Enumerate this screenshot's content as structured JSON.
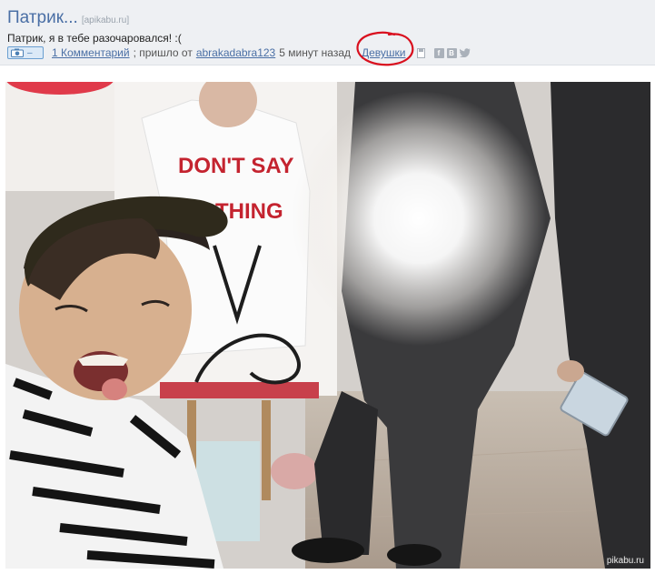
{
  "post": {
    "title": "Патрик...",
    "source": "[apikabu.ru]",
    "description": "Патрик, я в тебе разочаровался! :(",
    "comments_link": "1 Комментарий",
    "arrived_text": "; пришло от",
    "author": "abrakadabra123",
    "time_ago": "5 минут назад",
    "tag": "Девушки"
  },
  "icons": {
    "camera": "camera-icon",
    "save": "save-icon",
    "facebook": "facebook-icon",
    "vk": "vk-icon",
    "twitter": "twitter-icon"
  },
  "share": {
    "facebook_glyph": "f",
    "vk_glyph": "B"
  },
  "photo": {
    "shirt_text_line1": "DON'T SAY",
    "shirt_text_line2": "NOTHING",
    "watermark": "pikabu.ru"
  },
  "colors": {
    "header_bg": "#eef0f3",
    "link": "#4a6fa5",
    "annotation": "#d9101e"
  }
}
